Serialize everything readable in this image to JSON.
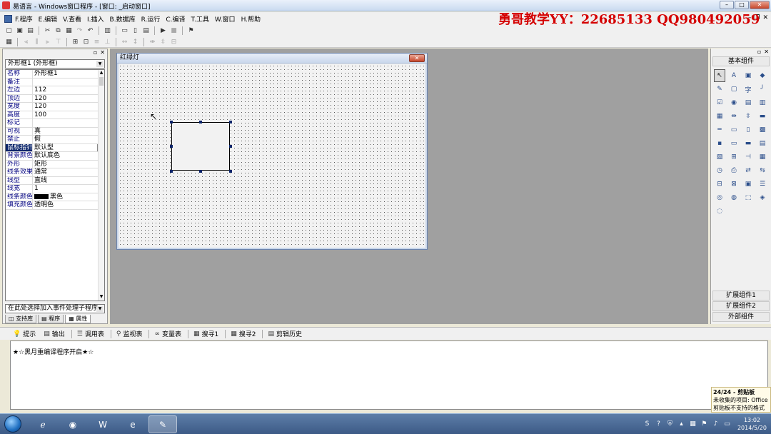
{
  "window": {
    "title": "易语言 - Windows窗口程序 - [窗口: _启动窗口]",
    "watermark": "勇哥教学YY：22685133 QQ980492059"
  },
  "menu": {
    "items": [
      "F.程序",
      "E.编辑",
      "V.查看",
      "I.插入",
      "B.数据库",
      "R.运行",
      "C.编译",
      "T.工具",
      "W.窗口",
      "H.帮助"
    ]
  },
  "property_panel": {
    "object_selector": "外形框1 (外形框)",
    "properties": [
      {
        "name": "名称",
        "value": "外形框1"
      },
      {
        "name": "备注",
        "value": ""
      },
      {
        "name": "左边",
        "value": "112"
      },
      {
        "name": "顶边",
        "value": "120"
      },
      {
        "name": "宽度",
        "value": "120"
      },
      {
        "name": "高度",
        "value": "100"
      },
      {
        "name": "标记",
        "value": ""
      },
      {
        "name": "可视",
        "value": "真"
      },
      {
        "name": "禁止",
        "value": "假"
      },
      {
        "name": "鼠标指针",
        "value": "默认型"
      },
      {
        "name": "背景颜色",
        "value": "默认底色"
      },
      {
        "name": "外形",
        "value": "矩形"
      },
      {
        "name": "线条效果",
        "value": "通常"
      },
      {
        "name": "线型",
        "value": "直线"
      },
      {
        "name": "线宽",
        "value": "1"
      },
      {
        "name": "线条颜色",
        "value": "黑色"
      },
      {
        "name": "填充颜色",
        "value": "透明色"
      }
    ],
    "event_selector": "在此处选择加入事件处理子程序",
    "tabs": [
      "支持库",
      "程序",
      "属性"
    ]
  },
  "design": {
    "form_title": "红绿灯"
  },
  "component_panel": {
    "header": "基本组件",
    "groups": [
      "扩展组件1",
      "扩展组件2",
      "外部组件"
    ]
  },
  "output_panel": {
    "tabs": [
      "提示",
      "输出",
      "调用表",
      "监视表",
      "变量表",
      "搜寻1",
      "搜寻2",
      "剪辑历史"
    ],
    "message": "★☆黑月重编译程序开启★☆"
  },
  "notification": {
    "title": "24/24 - 剪贴板",
    "line1": "未收集的项目: Office",
    "line2": "剪贴板不支持的格式"
  },
  "taskbar": {
    "time": "13:02",
    "date": "2014/5/20"
  }
}
